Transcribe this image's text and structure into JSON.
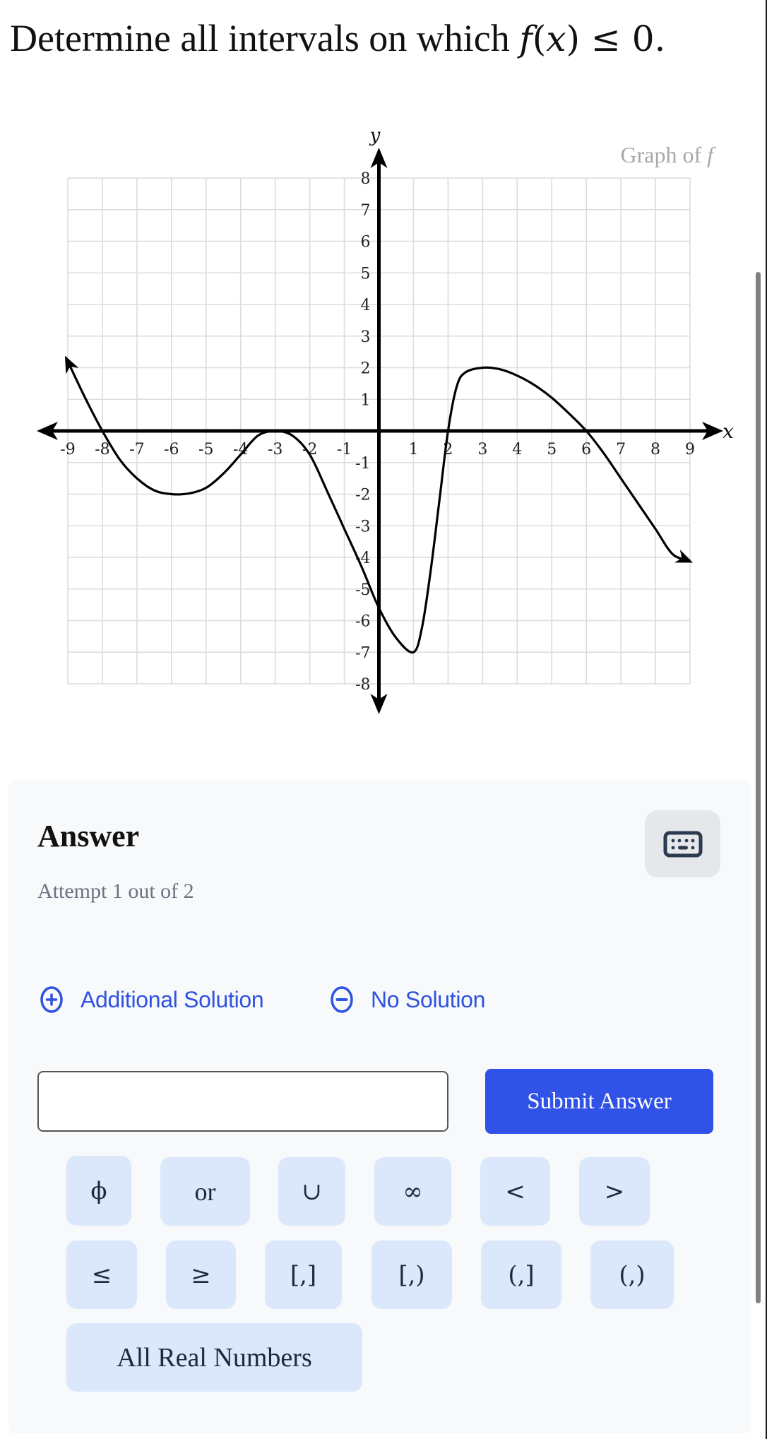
{
  "question": {
    "prefix": "Determine all intervals on which ",
    "math_f": "f",
    "math_open": "(",
    "math_x": "x",
    "math_close": ")",
    "math_rel": " ≤ 0."
  },
  "chart_data": {
    "type": "line",
    "title": "Graph of f",
    "title_prefix": "Graph of ",
    "title_var": "f",
    "xlabel": "x",
    "ylabel": "y",
    "xlim": [
      -9,
      9
    ],
    "ylim": [
      -8,
      8
    ],
    "grid": true,
    "x_ticks": [
      -9,
      -8,
      -7,
      -6,
      -5,
      -4,
      -3,
      -2,
      -1,
      1,
      2,
      3,
      4,
      5,
      6,
      7,
      8,
      9
    ],
    "y_ticks": [
      -8,
      -7,
      -6,
      -5,
      -4,
      -3,
      -2,
      -1,
      1,
      2,
      3,
      4,
      5,
      6,
      7,
      8
    ],
    "series": [
      {
        "name": "f",
        "arrow_start": true,
        "arrow_end": true,
        "points": [
          [
            -9,
            2.2
          ],
          [
            -8.5,
            1.05
          ],
          [
            -8,
            0
          ],
          [
            -7.5,
            -0.9
          ],
          [
            -7,
            -1.5
          ],
          [
            -6.5,
            -1.88
          ],
          [
            -6,
            -2
          ],
          [
            -5.5,
            -1.98
          ],
          [
            -5,
            -1.8
          ],
          [
            -4.5,
            -1.35
          ],
          [
            -4,
            -0.75
          ],
          [
            -3.5,
            -0.15
          ],
          [
            -3,
            0
          ],
          [
            -2.5,
            -0.15
          ],
          [
            -2,
            -0.75
          ],
          [
            -1.5,
            -1.9
          ],
          [
            -1,
            -3.1
          ],
          [
            -0.5,
            -4.3
          ],
          [
            0,
            -5.6
          ],
          [
            0.5,
            -6.55
          ],
          [
            1,
            -7
          ],
          [
            1.25,
            -6.2
          ],
          [
            1.5,
            -4.4
          ],
          [
            1.75,
            -2.2
          ],
          [
            2,
            0
          ],
          [
            2.25,
            1.4
          ],
          [
            2.5,
            1.85
          ],
          [
            3,
            2
          ],
          [
            3.5,
            1.95
          ],
          [
            4,
            1.75
          ],
          [
            4.5,
            1.45
          ],
          [
            5,
            1.05
          ],
          [
            5.5,
            0.55
          ],
          [
            6,
            0
          ],
          [
            6.5,
            -0.7
          ],
          [
            7,
            -1.5
          ],
          [
            7.5,
            -2.3
          ],
          [
            8,
            -3.1
          ],
          [
            8.5,
            -3.9
          ],
          [
            9,
            -4.1
          ]
        ],
        "key_points": {
          "x_intercepts": [
            -8,
            -3,
            2,
            6
          ],
          "local_min": [
            [
              -6,
              -2
            ],
            [
              1,
              -7
            ]
          ],
          "local_max": [
            [
              -3,
              0
            ],
            [
              3,
              2
            ]
          ],
          "y_intercept": -5.6
        }
      }
    ]
  },
  "answer": {
    "heading": "Answer",
    "attempt": "Attempt 1 out of 2",
    "additional_solution": "Additional Solution",
    "no_solution": "No Solution",
    "input_value": "",
    "input_placeholder": "",
    "submit_label": "Submit Answer",
    "keyboard_icon": "keyboard-icon"
  },
  "keypad": {
    "row1": [
      "ϕ",
      "or",
      "∪",
      "∞",
      "<",
      ">"
    ],
    "row2": [
      "≤",
      "≥",
      "[,]",
      "[,)",
      "(,]",
      "(,)"
    ],
    "row3": [
      "All Real Numbers"
    ]
  },
  "colors": {
    "accent": "#3052e6",
    "link": "#2f52e0",
    "key_bg": "#dbe8fb",
    "panel_bg": "#f7f9fb",
    "muted_text": "#6b7280"
  }
}
